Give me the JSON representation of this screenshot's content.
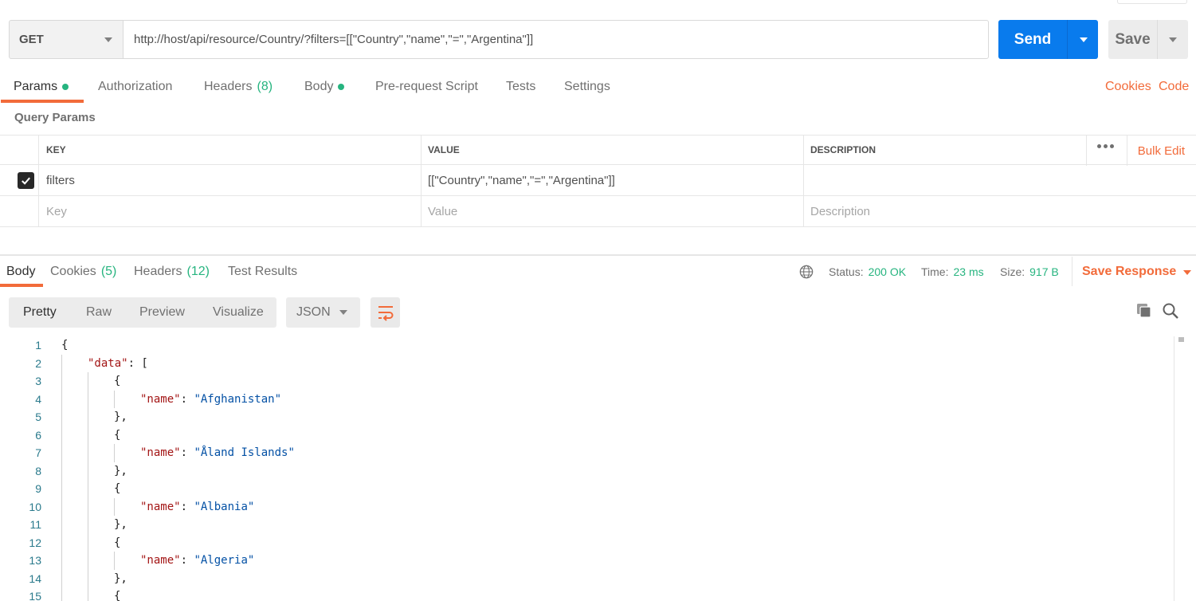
{
  "request": {
    "method": "GET",
    "url": "http://host/api/resource/Country/?filters=[[\"Country\",\"name\",\"=\",\"Argentina\"]]",
    "send_label": "Send",
    "save_label": "Save"
  },
  "request_tabs": [
    {
      "label": "Params",
      "dot": true
    },
    {
      "label": "Authorization"
    },
    {
      "label": "Headers",
      "count": "(8)"
    },
    {
      "label": "Body",
      "dot": true
    },
    {
      "label": "Pre-request Script"
    },
    {
      "label": "Tests"
    },
    {
      "label": "Settings"
    }
  ],
  "links": {
    "cookies": "Cookies",
    "code": "Code"
  },
  "query_params": {
    "title": "Query Params",
    "headers": {
      "key": "KEY",
      "value": "VALUE",
      "description": "DESCRIPTION"
    },
    "bulk_edit": "Bulk Edit",
    "rows": [
      {
        "checked": true,
        "key": "filters",
        "value": "[[\"Country\",\"name\",\"=\",\"Argentina\"]]",
        "description": ""
      }
    ],
    "placeholders": {
      "key": "Key",
      "value": "Value",
      "description": "Description"
    }
  },
  "response_tabs": [
    {
      "label": "Body"
    },
    {
      "label": "Cookies",
      "count": "(5)"
    },
    {
      "label": "Headers",
      "count": "(12)"
    },
    {
      "label": "Test Results"
    }
  ],
  "status": {
    "status_label": "Status:",
    "status_value": "200 OK",
    "time_label": "Time:",
    "time_value": "23 ms",
    "size_label": "Size:",
    "size_value": "917 B",
    "save_response": "Save Response"
  },
  "format": {
    "views": [
      "Pretty",
      "Raw",
      "Preview",
      "Visualize"
    ],
    "language": "JSON"
  },
  "code_lines": [
    {
      "n": "1",
      "indent": 0,
      "parts": [
        [
          "p",
          "{"
        ]
      ]
    },
    {
      "n": "2",
      "indent": 1,
      "parts": [
        [
          "k",
          "\"data\""
        ],
        [
          "p",
          ": ["
        ]
      ]
    },
    {
      "n": "3",
      "indent": 2,
      "parts": [
        [
          "p",
          "{"
        ]
      ]
    },
    {
      "n": "4",
      "indent": 3,
      "parts": [
        [
          "k",
          "\"name\""
        ],
        [
          "p",
          ": "
        ],
        [
          "s",
          "\"Afghanistan\""
        ]
      ]
    },
    {
      "n": "5",
      "indent": 2,
      "parts": [
        [
          "p",
          "},"
        ]
      ]
    },
    {
      "n": "6",
      "indent": 2,
      "parts": [
        [
          "p",
          "{"
        ]
      ]
    },
    {
      "n": "7",
      "indent": 3,
      "parts": [
        [
          "k",
          "\"name\""
        ],
        [
          "p",
          ": "
        ],
        [
          "s",
          "\"Åland Islands\""
        ]
      ]
    },
    {
      "n": "8",
      "indent": 2,
      "parts": [
        [
          "p",
          "},"
        ]
      ]
    },
    {
      "n": "9",
      "indent": 2,
      "parts": [
        [
          "p",
          "{"
        ]
      ]
    },
    {
      "n": "10",
      "indent": 3,
      "parts": [
        [
          "k",
          "\"name\""
        ],
        [
          "p",
          ": "
        ],
        [
          "s",
          "\"Albania\""
        ]
      ]
    },
    {
      "n": "11",
      "indent": 2,
      "parts": [
        [
          "p",
          "},"
        ]
      ]
    },
    {
      "n": "12",
      "indent": 2,
      "parts": [
        [
          "p",
          "{"
        ]
      ]
    },
    {
      "n": "13",
      "indent": 3,
      "parts": [
        [
          "k",
          "\"name\""
        ],
        [
          "p",
          ": "
        ],
        [
          "s",
          "\"Algeria\""
        ]
      ]
    },
    {
      "n": "14",
      "indent": 2,
      "parts": [
        [
          "p",
          "},"
        ]
      ]
    },
    {
      "n": "15",
      "indent": 2,
      "parts": [
        [
          "p",
          "{"
        ]
      ]
    }
  ],
  "colors": {
    "accent": "#f26b3a",
    "send": "#097bed",
    "success": "#26b47f"
  }
}
